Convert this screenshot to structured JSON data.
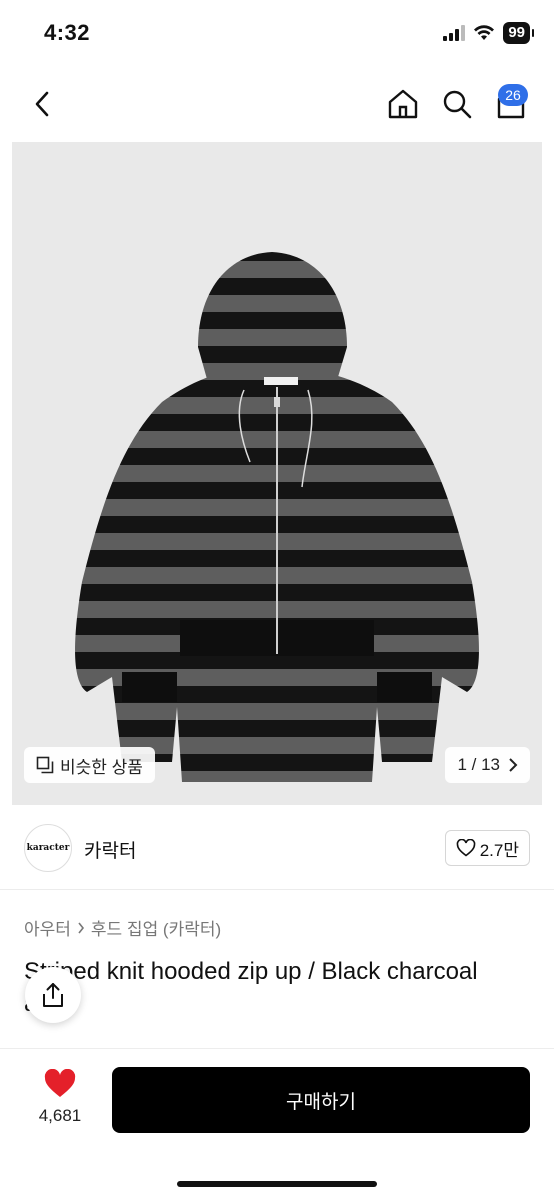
{
  "status": {
    "time": "4:32",
    "battery": "99"
  },
  "nav": {
    "cart_count": "26"
  },
  "gallery": {
    "similar_label": "비슷한 상품",
    "page_indicator": "1 / 13"
  },
  "brand": {
    "logo_text": "karacter",
    "name": "카락터",
    "likes": "2.7만"
  },
  "product": {
    "category_1": "아우터",
    "category_2": "후드 집업 (카락터)",
    "title": "Striped knit hooded zip up / Black charcoal",
    "title_overflow": "al"
  },
  "bottom": {
    "wish_count": "4,681",
    "buy_label": "구매하기"
  },
  "colors": {
    "badge": "#2f6fe8",
    "heart": "#e4202a",
    "buy_button": "#000000"
  }
}
